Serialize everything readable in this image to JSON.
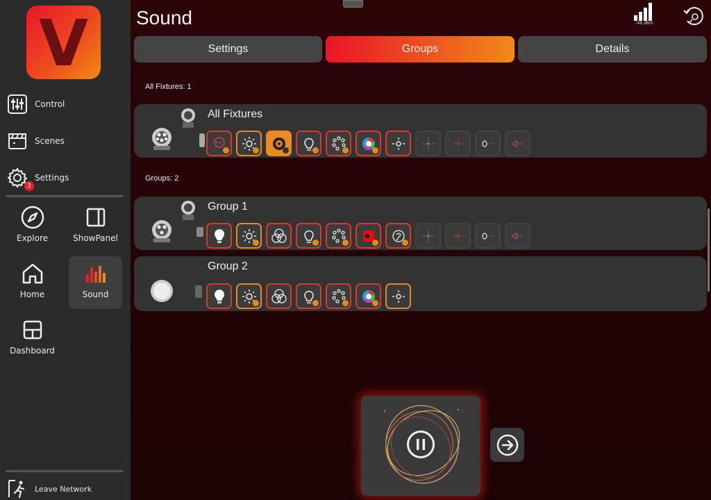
{
  "app": {
    "logo_letter": "V",
    "page_title": "Sound",
    "signal_label": "-46 dBm",
    "accent_color": "#ea1428",
    "accent_color_end": "#f08a17"
  },
  "sidebar": {
    "menu": [
      {
        "label": "Control",
        "icon": "sliders-icon"
      },
      {
        "label": "Scenes",
        "icon": "clapperboard-icon"
      },
      {
        "label": "Settings",
        "icon": "gear-icon",
        "badge": "3"
      }
    ],
    "tiles": [
      {
        "label": "Explore",
        "icon": "compass-icon"
      },
      {
        "label": "ShowPanel",
        "icon": "panel-icon"
      },
      {
        "label": "Home",
        "icon": "home-icon"
      },
      {
        "label": "Sound",
        "icon": "sound-bars-icon",
        "active": true
      },
      {
        "label": "Dashboard",
        "icon": "dashboard-icon"
      }
    ],
    "leave_label": "Leave Network"
  },
  "tabs": [
    {
      "label": "Settings",
      "active": false
    },
    {
      "label": "Groups",
      "active": true
    },
    {
      "label": "Details",
      "active": false
    }
  ],
  "sections": {
    "all_fixtures_label": "All Fixtures: 1",
    "groups_label": "Groups: 2"
  },
  "groups": [
    {
      "name": "All Fixtures"
    },
    {
      "name": "Group 1"
    },
    {
      "name": "Group 2"
    }
  ],
  "player": {
    "state": "paused"
  }
}
